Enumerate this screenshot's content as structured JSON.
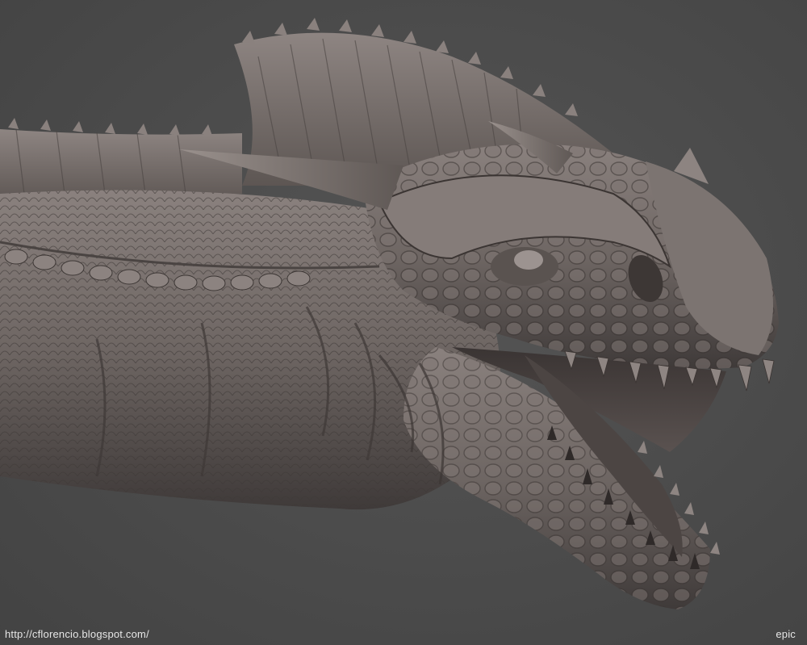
{
  "image": {
    "subject": "dragon-head-sculpt",
    "background_color": "#4a4a4a",
    "sculpt_color": "#6b6361"
  },
  "footer": {
    "credit_url": "http://cflorencio.blogspot.com/",
    "tag": "epic"
  }
}
